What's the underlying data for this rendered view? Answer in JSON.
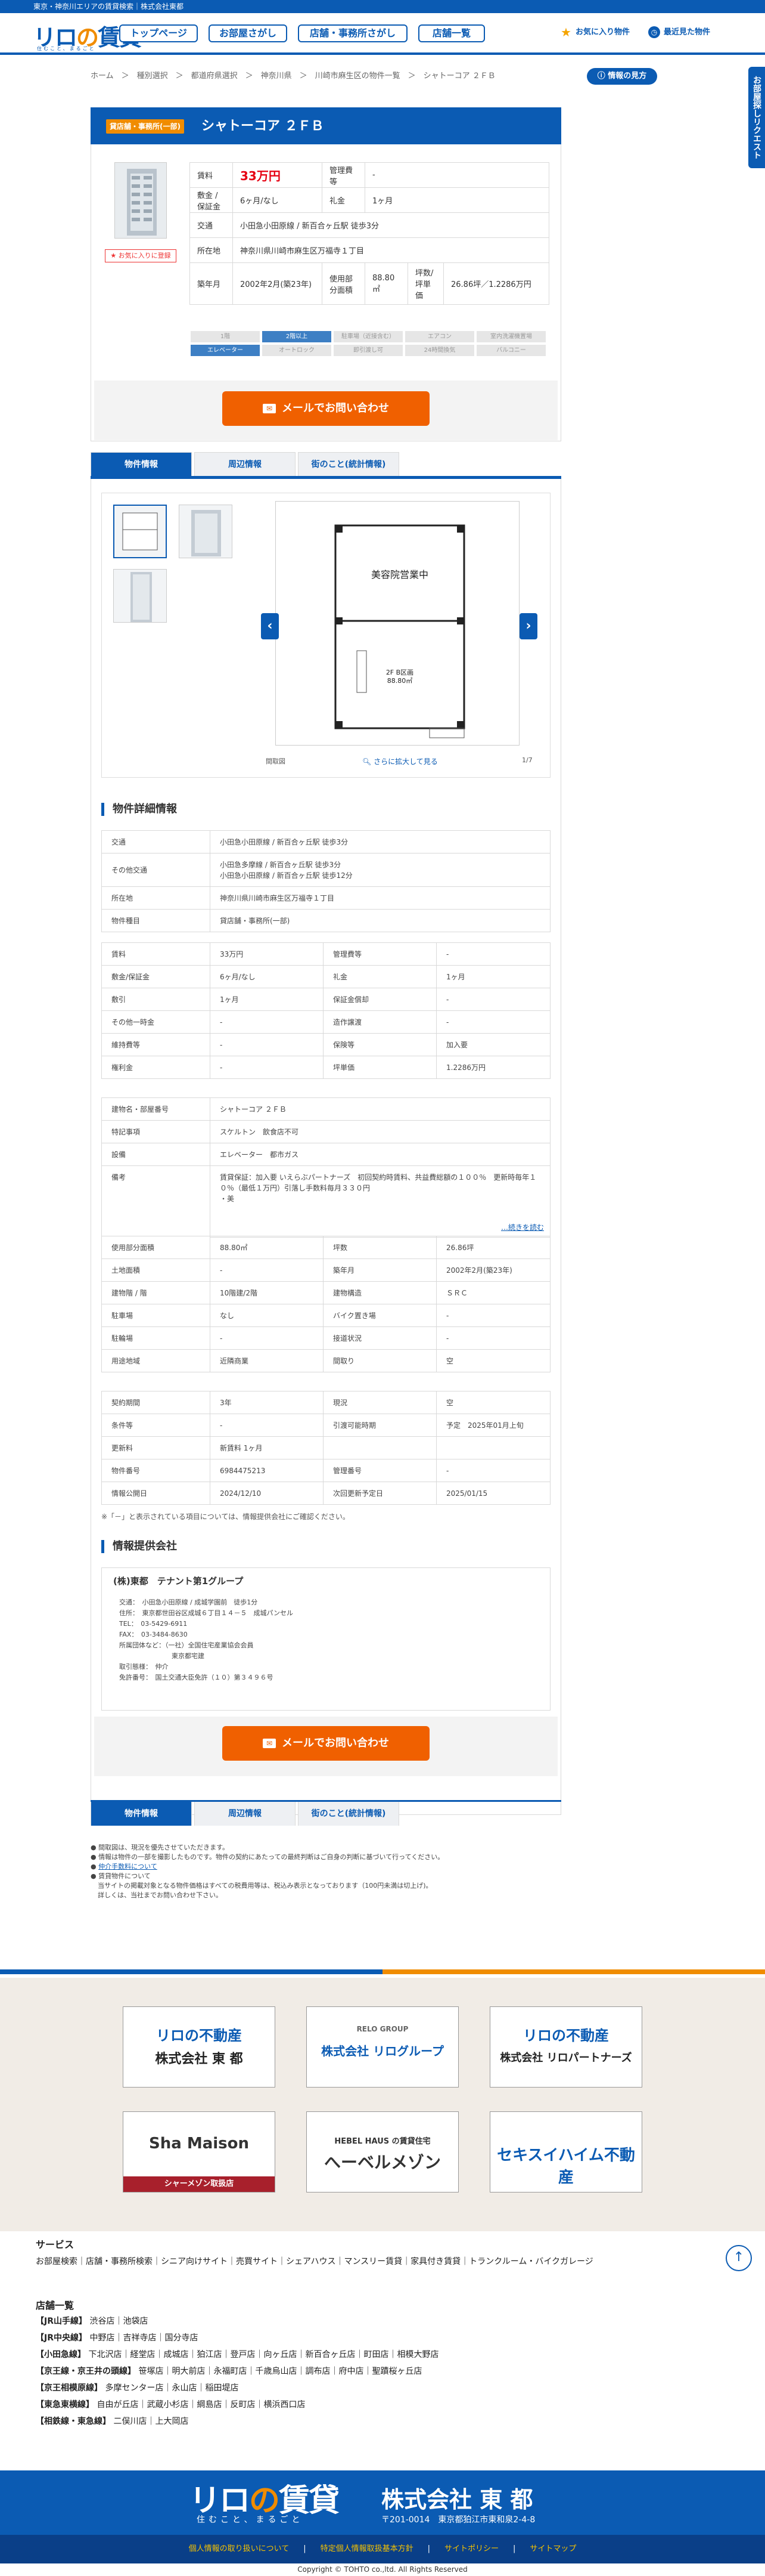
{
  "top_note": "東京・神奈川エリアの賃貸検索｜株式会社東都",
  "logo": {
    "main": "リロの賃貸",
    "sub": "住むこと、まるごと"
  },
  "nav": [
    "トップページ",
    "お部屋さがし",
    "店舗・事務所さがし",
    "店舗一覧"
  ],
  "header_links": {
    "favorite": "お気に入り物件",
    "history": "最近見た物件"
  },
  "breadcrumb": "ホーム　＞　種別選択　＞　都道府県選択　＞　神奈川県　＞　川崎市麻生区の物件一覧　＞　シャトーコア ２ＦＢ",
  "guide_btn": "情報の見方",
  "side_tab": "お部屋探しリクエスト",
  "property": {
    "type_badge": "貸店舗・事務所(一部)",
    "title": "シャトーコア ２ＦＢ",
    "fav_btn": "★ お気に入りに登録",
    "summary": [
      {
        "h": "賃料",
        "v": "33万円",
        "h2": "管理費等",
        "v2": "-"
      },
      {
        "h": "敷金 / 保証金",
        "v": "6ヶ月/なし",
        "h2": "礼金",
        "v2": "1ヶ月"
      },
      {
        "h": "交通",
        "v": "小田急小田原線 / 新百合ヶ丘駅 徒歩3分"
      },
      {
        "h": "所在地",
        "v": "神奈川県川崎市麻生区万福寺１丁目"
      },
      {
        "h": "築年月",
        "v": "2002年2月(築23年)",
        "h2": "使用部分面積",
        "v2": "88.80㎡",
        "h3": "坪数/坪単価",
        "v3": "26.86坪／1.2286万円"
      }
    ],
    "chips": [
      "1階",
      "2階以上",
      "駐車場（近接含む）",
      "エアコン",
      "室内洗濯機置場",
      "エレベーター",
      "オートロック",
      "即引渡し可",
      "24時間換気",
      "バルコニー"
    ],
    "chips_on": [
      1,
      5
    ]
  },
  "mail_btn": "メールでお問い合わせ",
  "tabs": [
    "物件情報",
    "周辺情報",
    "街のこと(統計情報)"
  ],
  "gallery": {
    "floor_title": "美容院営業中",
    "floor_label": "2F B区画\n88.80㎡",
    "caption": "間取図",
    "zoom": "さらに拡大して見る",
    "counter": "1/7",
    "prev": "‹",
    "next": "›"
  },
  "detail_title": "物件詳細情報",
  "detail_a": [
    {
      "h": "交通",
      "v": "小田急小田原線 / 新百合ヶ丘駅 徒歩3分"
    },
    {
      "h": "その他交通",
      "v": "小田急多摩線 / 新百合ヶ丘駅 徒歩3分\n小田急小田原線 / 新百合ヶ丘駅 徒歩12分"
    },
    {
      "h": "所在地",
      "v": "神奈川県川崎市麻生区万福寺１丁目"
    },
    {
      "h": "物件種目",
      "v": "貸店舗・事務所(一部)"
    }
  ],
  "detail_b": [
    [
      "賃料",
      "33万円",
      "管理費等",
      "-"
    ],
    [
      "敷金/保証金",
      "6ヶ月/なし",
      "礼金",
      "1ヶ月"
    ],
    [
      "敷引",
      "1ヶ月",
      "保証金償却",
      "-"
    ],
    [
      "その他一時金",
      "-",
      "造作譲渡",
      "-"
    ],
    [
      "維持費等",
      "-",
      "保険等",
      "加入要"
    ],
    [
      "権利金",
      "-",
      "坪単価",
      "1.2286万円"
    ]
  ],
  "detail_c": [
    {
      "h": "建物名・部屋番号",
      "v": "シャトーコア ２ＦＢ"
    },
    {
      "h": "特記事項",
      "v": "スケルトン　飲食店不可"
    },
    {
      "h": "設備",
      "v": "エレベーター　都市ガス"
    },
    {
      "h": "備考",
      "v": "賃貸保証：加入要 いえらぶパートナーズ　初回契約時賃料、共益費総額の１００％　更新時毎年１０％（最低１万円）引落し手数料毎月３３０円\n・美",
      "more": "…続きを読む"
    }
  ],
  "detail_d": [
    [
      "使用部分面積",
      "88.80㎡",
      "坪数",
      "26.86坪"
    ],
    [
      "土地面積",
      "-",
      "築年月",
      "2002年2月(築23年)"
    ],
    [
      "建物階 / 階",
      "10階建/2階",
      "建物構造",
      "ＳＲＣ"
    ],
    [
      "駐車場",
      "なし",
      "バイク置き場",
      "-"
    ],
    [
      "駐輪場",
      "-",
      "接道状況",
      "-"
    ],
    [
      "用途地域",
      "近隣商業",
      "間取り",
      "空"
    ]
  ],
  "detail_e": [
    [
      "契約期間",
      "3年",
      "現況",
      "空"
    ],
    [
      "条件等",
      "-",
      "引渡可能時期",
      "予定　2025年01月上旬"
    ],
    [
      "更新料",
      "新賃料 1ヶ月",
      "",
      ""
    ],
    [
      "物件番号",
      "6984475213",
      "管理番号",
      "-"
    ],
    [
      "情報公開日",
      "2024/12/10",
      "次回更新予定日",
      "2025/01/15"
    ]
  ],
  "detail_note": "※「－」と表示されている項目については、情報提供会社にご確認ください。",
  "provider": {
    "title": "情報提供会社",
    "name": "(株)東都　テナント第1グループ",
    "lines": [
      "交通：　小田急小田原線 / 成城学園前　徒歩1分",
      "住所：　東京都世田谷区成城６丁目１４－５　成城パンセル",
      "TEL：　03-5429-6911",
      "FAX：　03-3484-8630",
      "所属団体など：（一社）全国住宅産業協会会員",
      "　　　　　　　　東京都宅建",
      "取引態様：　仲介",
      "免許番号：　国土交通大臣免許（１０）第３４９６号"
    ]
  },
  "notes": [
    "間取図は、現況を優先させていただきます。",
    "情報は物件の一部を撮影したものです。物件の契約にあたっての最終判断はご自身の判断に基づいて行ってください。",
    "仲介手数料について",
    "賃貸物件について",
    "当サイトの掲載対象となる物件価格はすべての税費用等は、税込み表示となっております（100円未満は切上げ)。\n詳しくは、当社までお問い合わせ下さい。"
  ],
  "companies": [
    {
      "line1": "リロの不動産",
      "line2": "株式会社 東 都"
    },
    {
      "line1": "RELO GROUP",
      "line2": "株式会社 リログループ"
    },
    {
      "line1": "リロの不動産",
      "line2": "株式会社 リロパートナーズ"
    },
    {
      "line1": "Sha Maison",
      "line2": "シャーメゾン取扱店"
    },
    {
      "line1": "HEBEL HAUS の賃貸住宅",
      "line2": "へーベルメゾン"
    },
    {
      "line1": "セキスイハイム不動産",
      "line2": ""
    }
  ],
  "services": {
    "title": "サービス",
    "text": "お部屋検索｜店舗・事務所検索｜シニア向けサイト｜売買サイト｜シェアハウス｜マンスリー賃貸｜家具付き賃貸｜トランクルーム・バイクガレージ"
  },
  "stores": {
    "title": "店舗一覧",
    "rows": [
      {
        "line": "【JR山手線】",
        "names": "渋谷店｜池袋店"
      },
      {
        "line": "【JR中央線】",
        "names": "中野店｜吉祥寺店｜国分寺店"
      },
      {
        "line": "【小田急線】",
        "names": "下北沢店｜経堂店｜成城店｜狛江店｜登戸店｜向ヶ丘店｜新百合ヶ丘店｜町田店｜相模大野店"
      },
      {
        "line": "【京王線・京王井の頭線】",
        "names": "笹塚店｜明大前店｜永福町店｜千歳烏山店｜調布店｜府中店｜聖蹟桜ヶ丘店"
      },
      {
        "line": "【京王相模原線】",
        "names": "多摩センター店｜永山店｜稲田堤店"
      },
      {
        "line": "【東急東横線】",
        "names": "自由が丘店｜武蔵小杉店｜綱島店｜反町店｜横浜西口店"
      },
      {
        "line": "【相鉄線・東急線】",
        "names": "二俣川店｜上大岡店"
      }
    ]
  },
  "footer": {
    "logo": "リロの賃貸",
    "logo_sub": "住むこと、まるごと",
    "company": "株式会社 東 都",
    "address": "〒201-0014　東京都狛江市東和泉2-4-8",
    "links": [
      "個人情報の取り扱いについて",
      "特定個人情報取扱基本方針",
      "サイトポリシー",
      "サイトマップ"
    ],
    "copyright": "Copyright © TOHTO co.,ltd. All Rights Reserved"
  },
  "colors": {
    "brand": "#0b5bb3",
    "accent": "#f08c00",
    "cta": "#f06000",
    "price": "#e60012"
  }
}
